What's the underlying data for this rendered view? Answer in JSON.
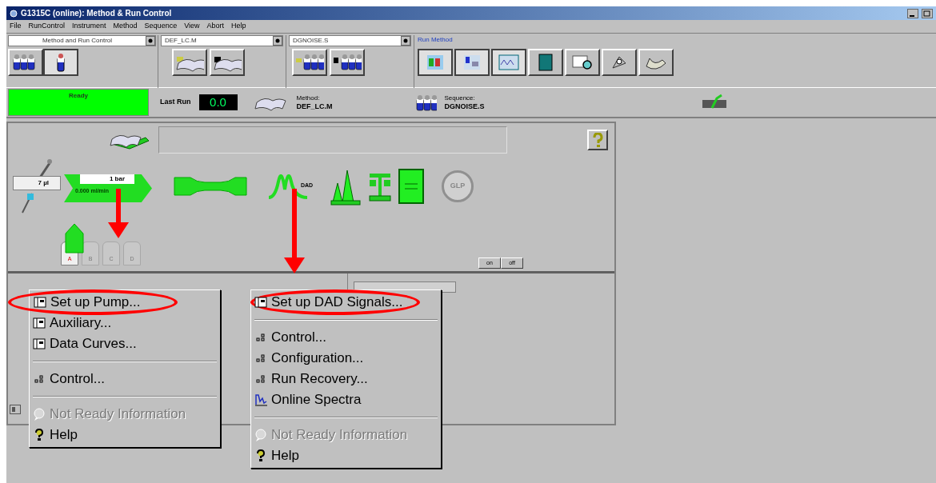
{
  "window": {
    "title": "G1315C (online): Method & Run Control"
  },
  "menu_bar": [
    "File",
    "RunControl",
    "Instrument",
    "Method",
    "Sequence",
    "View",
    "Abort",
    "Help"
  ],
  "toolbar": {
    "view_select": "Method and Run Control",
    "method_select": "DEF_LC.M",
    "sequence_select": "DGNOISE.S",
    "run_method_label": "Run Method"
  },
  "status": {
    "state": "Ready",
    "last_run_label": "Last Run",
    "last_run_value": "0.0",
    "method_label": "Method:",
    "method_value": "DEF_LC.M",
    "sequence_label": "Sequence:",
    "sequence_value": "DGNOISE.S"
  },
  "instrument": {
    "injector_volume": "7 µl",
    "pump_pressure": "1 bar",
    "pump_flow": "0.000 ml/min",
    "detector_label": "DAD",
    "glp": "GLP",
    "solvents": [
      {
        "label": "A",
        "selected": true
      },
      {
        "label": "B",
        "selected": false
      },
      {
        "label": "C",
        "selected": false
      },
      {
        "label": "D",
        "selected": false
      }
    ],
    "on_button": "on",
    "off_button": "off"
  },
  "context_menus": [
    {
      "items": [
        {
          "kind": "setup",
          "label": "Set up Pump...",
          "disabled": false,
          "circled": true
        },
        {
          "kind": "setup",
          "label": "Auxiliary...",
          "disabled": false,
          "circled": false
        },
        {
          "kind": "setup",
          "label": "Data Curves...",
          "disabled": false,
          "circled": false
        },
        {
          "kind": "separator"
        },
        {
          "kind": "control",
          "label": "Control...",
          "disabled": false,
          "circled": false
        },
        {
          "kind": "separator"
        },
        {
          "kind": "info",
          "label": "Not Ready Information",
          "disabled": true,
          "circled": false
        },
        {
          "kind": "help",
          "label": "Help",
          "disabled": false,
          "circled": false
        }
      ]
    },
    {
      "items": [
        {
          "kind": "setup",
          "label": "Set up DAD Signals...",
          "disabled": false,
          "circled": true
        },
        {
          "kind": "separator"
        },
        {
          "kind": "control",
          "label": "Control...",
          "disabled": false,
          "circled": false
        },
        {
          "kind": "control",
          "label": "Configuration...",
          "disabled": false,
          "circled": false
        },
        {
          "kind": "control",
          "label": "Run Recovery...",
          "disabled": false,
          "circled": false
        },
        {
          "kind": "spectra",
          "label": "Online Spectra",
          "disabled": false,
          "circled": false
        },
        {
          "kind": "separator"
        },
        {
          "kind": "info",
          "label": "Not Ready Information",
          "disabled": true,
          "circled": false
        },
        {
          "kind": "help",
          "label": "Help",
          "disabled": false,
          "circled": false
        }
      ]
    }
  ]
}
